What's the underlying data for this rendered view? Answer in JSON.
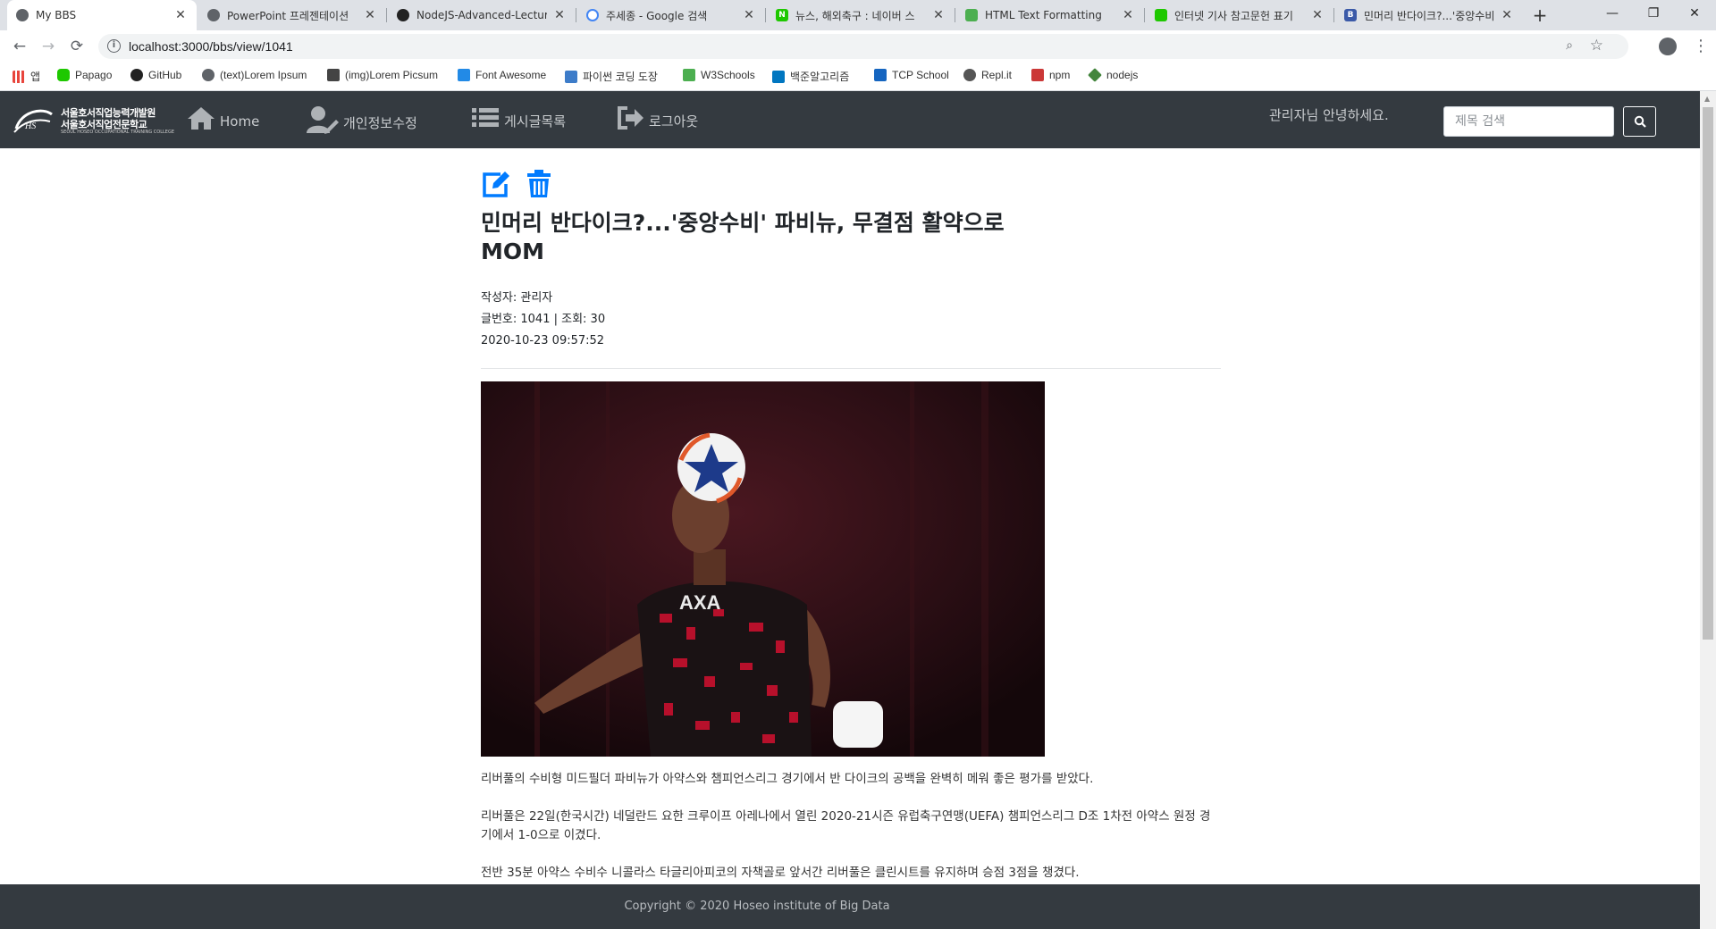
{
  "browser": {
    "tabs": [
      {
        "title": "My BBS",
        "active": true,
        "icon": "globe-icon"
      },
      {
        "title": "PowerPoint 프레젠테이션",
        "active": false,
        "icon": "globe-icon"
      },
      {
        "title": "NodeJS-Advanced-Lecture",
        "active": false,
        "icon": "github-icon"
      },
      {
        "title": "주세종 - Google 검색",
        "active": false,
        "icon": "google-icon"
      },
      {
        "title": "뉴스, 해외축구 : 네이버 스",
        "active": false,
        "icon": "naver-icon"
      },
      {
        "title": "HTML Text Formatting",
        "active": false,
        "icon": "w3schools-icon"
      },
      {
        "title": "인터넷 기사 참고문헌 표기",
        "active": false,
        "icon": "blog-icon"
      },
      {
        "title": "민머리 반다이크?...'중앙수비",
        "active": false,
        "icon": "bbs-icon"
      }
    ],
    "url": "localhost:3000/bbs/view/1041",
    "bookmarks": [
      {
        "label": "앱",
        "icon": "apps-grid-icon",
        "color": "#e8453c"
      },
      {
        "label": "Papago",
        "icon": "papago-icon",
        "color": "#1ec800"
      },
      {
        "label": "GitHub",
        "icon": "github-icon",
        "color": "#222222"
      },
      {
        "label": "(text)Lorem Ipsum",
        "icon": "globe-icon",
        "color": "#5f6368"
      },
      {
        "label": "(img)Lorem Picsum",
        "icon": "picsum-icon",
        "color": "#444444"
      },
      {
        "label": "Font Awesome",
        "icon": "font-awesome-icon",
        "color": "#228ae6"
      },
      {
        "label": "파이썬 코딩 도장",
        "icon": "dojang-icon",
        "color": "#3d7cc9"
      },
      {
        "label": "W3Schools",
        "icon": "w3schools-icon",
        "color": "#4caf50"
      },
      {
        "label": "백준알고리즘",
        "icon": "baekjoon-icon",
        "color": "#0076c0"
      },
      {
        "label": "TCP School",
        "icon": "tcpschool-icon",
        "color": "#1565c0"
      },
      {
        "label": "Repl.it",
        "icon": "replit-icon",
        "color": "#555555"
      },
      {
        "label": "npm",
        "icon": "npm-icon",
        "color": "#cb3837"
      },
      {
        "label": "nodejs",
        "icon": "nodejs-icon",
        "color": "#43853d"
      }
    ]
  },
  "site": {
    "logo": {
      "line1": "서울호서직업능력개발원",
      "line2": "서울호서직업전문학교",
      "line3": "SEOUL HOSEO OCCUPATIONAL TRAINING COLLEGE"
    },
    "nav": [
      {
        "label": "Home",
        "icon": "home-icon"
      },
      {
        "label": "개인정보수정",
        "icon": "user-edit-icon"
      },
      {
        "label": "게시글목록",
        "icon": "list-icon"
      },
      {
        "label": "로그아웃",
        "icon": "sign-out-icon"
      }
    ],
    "greeting": "관리자님 안녕하세요.",
    "search": {
      "placeholder": "제목 검색",
      "value": ""
    },
    "accent": "#007bff",
    "navbar_color": "#343a40"
  },
  "post": {
    "title": "민머리 반다이크?...'중앙수비' 파비뉴, 무결점 활약으로 MOM",
    "author_line": "작성자: 관리자",
    "number_line": "글번호: 1041 | 조회: 30",
    "date": "2020-10-23 09:57:52",
    "paragraphs": [
      "리버풀의 수비형 미드필더 파비뉴가 아약스와 챔피언스리그 경기에서 반 다이크의 공백을 완벽히 메워 좋은 평가를 받았다.",
      "리버풀은 22일(한국시간) 네덜란드 요한 크루이프 아레나에서 열린 2020-21시즌 유럽축구연맹(UEFA) 챔피언스리그 D조 1차전 아약스 원정 경기에서 1-0으로 이겼다.",
      "전반 35분 아약스 수비수 니콜라스 타글리아피코의 자책골로 앞서간 리버풀은 클린시트를 유지하며 승점 3점을 챙겼다."
    ]
  },
  "footer": {
    "copyright": "Copyright © 2020 Hoseo institute of Big Data"
  }
}
